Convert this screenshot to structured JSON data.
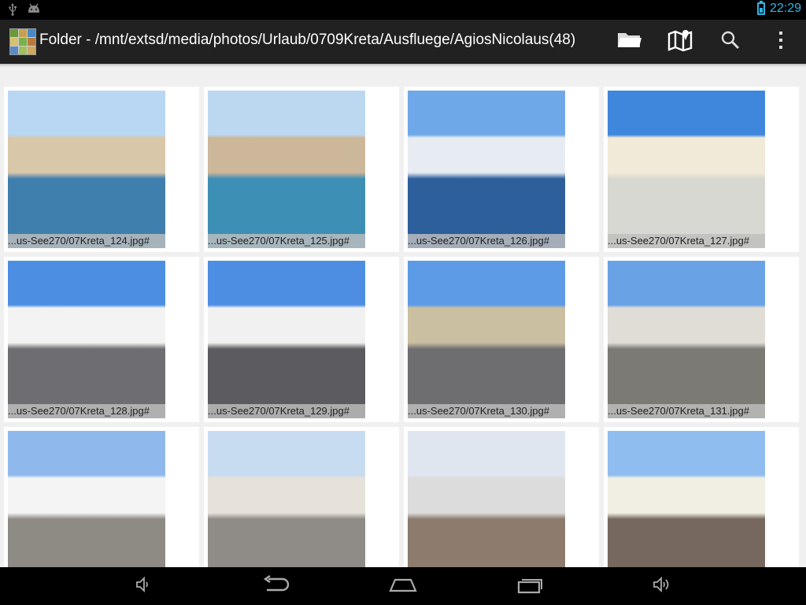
{
  "status_bar": {
    "time": "22:29",
    "icons": [
      "usb-icon",
      "android-debug-icon",
      "battery-charging-icon"
    ]
  },
  "action_bar": {
    "title": "Folder - /mnt/extsd/media/photos/Urlaub/0709Kreta/Ausfluege/AgiosNicolaus(48)",
    "actions": [
      "folder-icon",
      "map-icon",
      "search-icon",
      "overflow-menu-icon"
    ]
  },
  "photos": [
    {
      "caption": "...us-See270/07Kreta_124.jpg#",
      "sky": "#b9d7f2",
      "mid": "#d9c7aa",
      "low": "#3f7fae"
    },
    {
      "caption": "...us-See270/07Kreta_125.jpg#",
      "sky": "#bcd8f0",
      "mid": "#cdb79a",
      "low": "#3d8fb5"
    },
    {
      "caption": "...us-See270/07Kreta_126.jpg#",
      "sky": "#6fa8e8",
      "mid": "#e7ecf2",
      "low": "#2c5f9c"
    },
    {
      "caption": "...us-See270/07Kreta_127.jpg#",
      "sky": "#3f86dd",
      "mid": "#f1ead8",
      "low": "#d8d8d2"
    },
    {
      "caption": "...us-See270/07Kreta_128.jpg#",
      "sky": "#4c8fe2",
      "mid": "#f3f3f3",
      "low": "#6d6d72"
    },
    {
      "caption": "...us-See270/07Kreta_129.jpg#",
      "sky": "#4d8ee3",
      "mid": "#f1f1f1",
      "low": "#5b5b60"
    },
    {
      "caption": "...us-See270/07Kreta_130.jpg#",
      "sky": "#5d9be6",
      "mid": "#cbbfa2",
      "low": "#6e6e70"
    },
    {
      "caption": "...us-See270/07Kreta_131.jpg#",
      "sky": "#6aa2e6",
      "mid": "#e0ddd7",
      "low": "#7b7a75"
    },
    {
      "caption": "",
      "sky": "#8fb9ec",
      "mid": "#f4f4f4",
      "low": "#8e8a84"
    },
    {
      "caption": "",
      "sky": "#c7dcf1",
      "mid": "#e6e2da",
      "low": "#8f8b86"
    },
    {
      "caption": "",
      "sky": "#e0e6f0",
      "mid": "#dcdcdc",
      "low": "#8d7b6e"
    },
    {
      "caption": "",
      "sky": "#8fbdf0",
      "mid": "#f1efe4",
      "low": "#76685e"
    }
  ],
  "nav_bar": {
    "buttons": [
      "volume-down-icon",
      "back-icon",
      "home-icon",
      "recent-apps-icon",
      "volume-up-icon"
    ]
  },
  "colors": {
    "accent": "#33b5e5",
    "action_bar": "#212121",
    "background": "#f0f0f0"
  }
}
